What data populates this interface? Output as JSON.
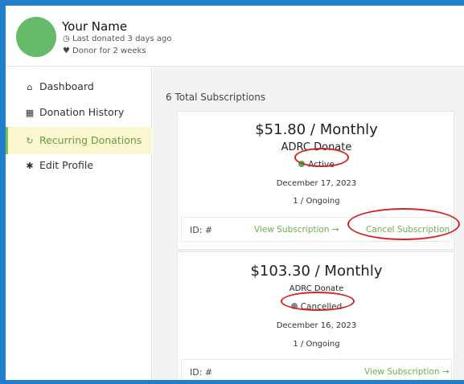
{
  "profile": {
    "name": "Your Name",
    "last_donated": "Last donated 3 days ago",
    "donor_for": "Donor for 2 weeks"
  },
  "nav": {
    "items": [
      {
        "label": "Dashboard",
        "icon": "home-icon",
        "active": false
      },
      {
        "label": "Donation History",
        "icon": "calendar-icon",
        "active": false
      },
      {
        "label": "Recurring Donations",
        "icon": "refresh-icon",
        "active": true
      },
      {
        "label": "Edit Profile",
        "icon": "gear-icon",
        "active": false
      }
    ]
  },
  "subscriptions": {
    "total_label": "6 Total Subscriptions",
    "items": [
      {
        "amount": "$51.80 / Monthly",
        "org": "ADRC Donate",
        "status": "Active",
        "status_color": "#4caf50",
        "date": "December 17, 2023",
        "term": "1 / Ongoing",
        "id_label": "ID: #",
        "view_label": "View Subscription →",
        "cancel_label": "Cancel Subscription"
      },
      {
        "amount": "$103.30 / Monthly",
        "org": "ADRC Donate",
        "status": "Cancelled",
        "status_color": "#888888",
        "date": "December 16, 2023",
        "term": "1 / Ongoing",
        "id_label": "ID: #",
        "view_label": "View Subscription →"
      }
    ]
  },
  "colors": {
    "accent_green": "#6ab04c",
    "active_nav_bg": "#fbf7d0",
    "annotation_red": "#d12626",
    "frame_blue": "#1f7fcc"
  }
}
